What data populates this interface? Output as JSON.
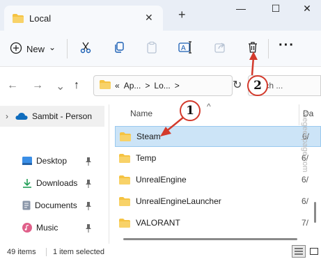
{
  "window": {
    "tab_title": "Local",
    "tab_close": "✕",
    "tab_add": "+",
    "minimize": "—",
    "maximize": "☐",
    "close": "✕"
  },
  "toolbar": {
    "new_label": "New",
    "new_chevron": "⌄",
    "more": "···"
  },
  "navigation": {
    "back": "←",
    "forward": "→",
    "up": "↑",
    "path_prefix": "«",
    "crumb_1": "Ap...",
    "crumb_2": "Lo...",
    "chevron": ">",
    "refresh": "↻",
    "search_placeholder": "earch ..."
  },
  "sidebar": {
    "onedrive_label": "Sambit - Person",
    "items": [
      {
        "label": "Desktop"
      },
      {
        "label": "Downloads"
      },
      {
        "label": "Documents"
      },
      {
        "label": "Music"
      }
    ],
    "pin": "📌"
  },
  "file_list": {
    "column_name": "Name",
    "column_sort": "^",
    "column_date": "Da",
    "rows": [
      {
        "name": "Steam",
        "date": "6/"
      },
      {
        "name": "Temp",
        "date": "6/"
      },
      {
        "name": "UnrealEngine",
        "date": "6/"
      },
      {
        "name": "UnrealEngineLauncher",
        "date": "6/"
      },
      {
        "name": "VALORANT",
        "date": "7/"
      }
    ]
  },
  "watermark": "thegeekpage.com",
  "status": {
    "items": "49 items",
    "selected": "1 item selected"
  },
  "callouts": {
    "one": "1",
    "two": "2"
  },
  "colors": {
    "accent_folder": "#f5c342",
    "selection": "#cce4f7",
    "callout_red": "#d33a2c"
  }
}
